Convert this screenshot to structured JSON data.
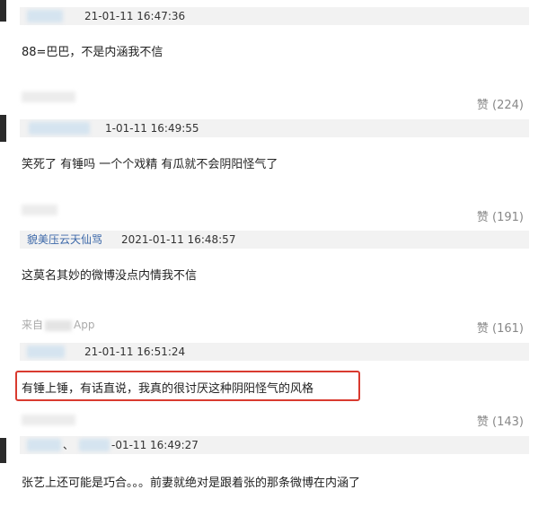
{
  "comments": [
    {
      "time": "21-01-11 16:47:36",
      "text": "88=巴巴，不是内涵我不信",
      "likes": "赞 (224)"
    },
    {
      "time": "1-01-11 16:49:55",
      "text": "笑死了 有锤吗 一个个戏精 有瓜就不会阴阳怪气了",
      "likes": "赞 (191)"
    },
    {
      "name": "貌美压云天仙骂",
      "time": "2021-01-11 16:48:57",
      "text": "这莫名其妙的微博没点内情我不信",
      "source_prefix": "来自",
      "source_suffix": "App",
      "likes": "赞 (161)"
    },
    {
      "time": "21-01-11 16:51:24",
      "text": "有锤上锤，有话直说，我真的很讨厌这种阴阳怪气的风格",
      "likes": "赞 (143)"
    },
    {
      "name_suffix": "、",
      "time": "-01-11 16:49:27",
      "text": "张艺上还可能是巧合。。。前妻就绝对是跟着张的那条微博在内涵了"
    }
  ]
}
